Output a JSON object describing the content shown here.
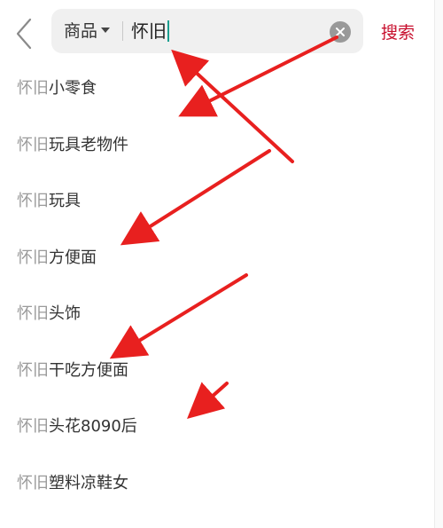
{
  "header": {
    "back_icon": "chevron-left-icon",
    "scope_label": "商品",
    "query": "怀旧",
    "clear_icon": "clear-icon",
    "search_label": "搜索"
  },
  "suggestions": [
    {
      "keyword": "怀旧",
      "rest": "小零食"
    },
    {
      "keyword": "怀旧",
      "rest": "玩具老物件"
    },
    {
      "keyword": "怀旧",
      "rest": "玩具"
    },
    {
      "keyword": "怀旧",
      "rest": "方便面"
    },
    {
      "keyword": "怀旧",
      "rest": "头饰"
    },
    {
      "keyword": "怀旧",
      "rest": "干吃方便面"
    },
    {
      "keyword": "怀旧",
      "rest": "头花8090后"
    },
    {
      "keyword": "怀旧",
      "rest": "塑料凉鞋女"
    }
  ],
  "colors": {
    "accent": "#c8102e",
    "keyword": "#9a9a9a",
    "text": "#333333",
    "annotation": "#e8201f",
    "cursor": "#1a9e8f"
  }
}
